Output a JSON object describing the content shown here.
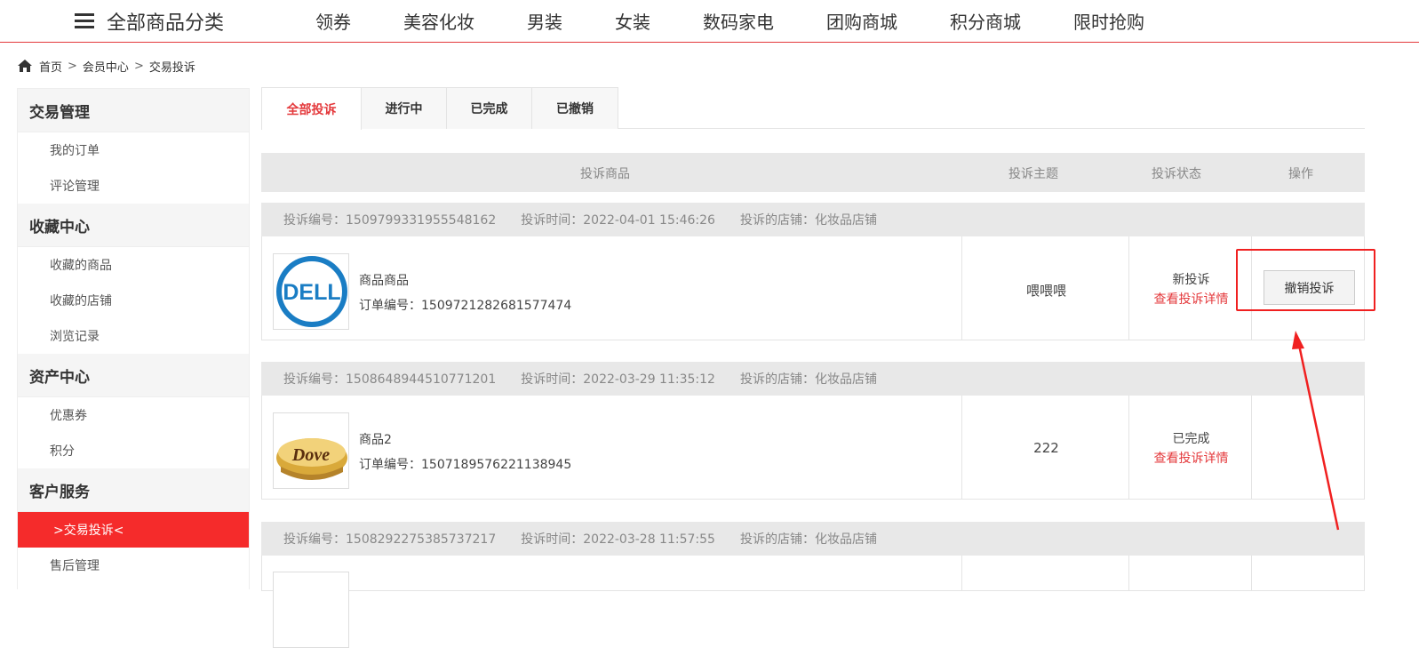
{
  "topnav": {
    "all_categories": "全部商品分类",
    "items": [
      "领券",
      "美容化妆",
      "男装",
      "女装",
      "数码家电",
      "团购商城",
      "积分商城",
      "限时抢购"
    ]
  },
  "breadcrumb": {
    "home": "首页",
    "sep": ">",
    "member": "会员中心",
    "current": "交易投诉"
  },
  "sidebar": {
    "groups": [
      {
        "title": "交易管理",
        "items": [
          "我的订单",
          "评论管理"
        ]
      },
      {
        "title": "收藏中心",
        "items": [
          "收藏的商品",
          "收藏的店铺",
          "浏览记录"
        ]
      },
      {
        "title": "资产中心",
        "items": [
          "优惠券",
          "积分"
        ]
      },
      {
        "title": "客户服务",
        "items": [
          ">交易投诉<",
          "售后管理"
        ]
      }
    ]
  },
  "tabs": [
    "全部投诉",
    "进行中",
    "已完成",
    "已撤销"
  ],
  "table_header": {
    "product": "投诉商品",
    "subject": "投诉主题",
    "status": "投诉状态",
    "action": "操作"
  },
  "labels": {
    "complaint_no": "投诉编号：",
    "complaint_time": "投诉时间：",
    "store": "投诉的店铺：",
    "order_no": "订单编号："
  },
  "complaints": [
    {
      "complaint_no": "1509799331955548162",
      "time": "2022-04-01 15:46:26",
      "store": "化妆品店铺",
      "product_name": "商品商品",
      "order_no": "1509721282681577474",
      "subject": "喂喂喂",
      "status": "新投诉",
      "detail_link": "查看投诉详情",
      "action": "撤销投诉",
      "thumb": "DELL"
    },
    {
      "complaint_no": "1508648944510771201",
      "time": "2022-03-29 11:35:12",
      "store": "化妆品店铺",
      "product_name": "商品2",
      "order_no": "1507189576221138945",
      "subject": "222",
      "status": "已完成",
      "detail_link": "查看投诉详情",
      "thumb": "Dove"
    },
    {
      "complaint_no": "1508292275385737217",
      "time": "2022-03-28 11:57:55",
      "store": "化妆品店铺"
    }
  ],
  "colors": {
    "accent": "#e4393c",
    "active_sidebar": "#f52b2b",
    "annotation": "#f02020"
  }
}
